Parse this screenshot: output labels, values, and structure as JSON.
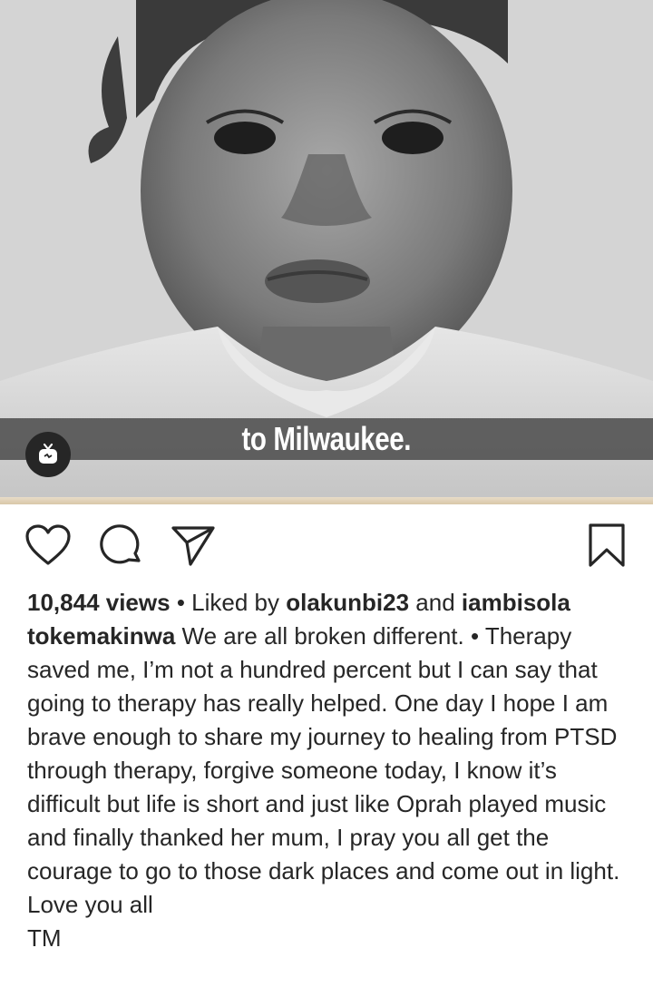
{
  "media": {
    "caption_overlay": "to Milwaukee.",
    "badge_icon": "igtv-icon",
    "content": "black-and-white photo of a young girl"
  },
  "actions": {
    "like_icon": "heart-outline-icon",
    "comment_icon": "comment-bubble-icon",
    "share_icon": "paper-plane-icon",
    "save_icon": "bookmark-outline-icon"
  },
  "stats": {
    "views": "10,844 views",
    "liked_by_prefix": "Liked by",
    "liker1": "olakunbi23",
    "and": "and",
    "liker2": "iambisola"
  },
  "post": {
    "username": "tokemakinwa",
    "caption": "We are all broken different. • Therapy saved me, I’m not a hundred percent but I can say that going to therapy has really helped. One day I hope I am brave enough to share my journey to healing from PTSD through therapy, forgive someone today, I know it’s difficult but life is short and just like Oprah played music and finally thanked her mum, I pray you all get the courage to go to those dark places and come out in light.",
    "signoff1": "Love you all",
    "signoff2": "TM"
  }
}
